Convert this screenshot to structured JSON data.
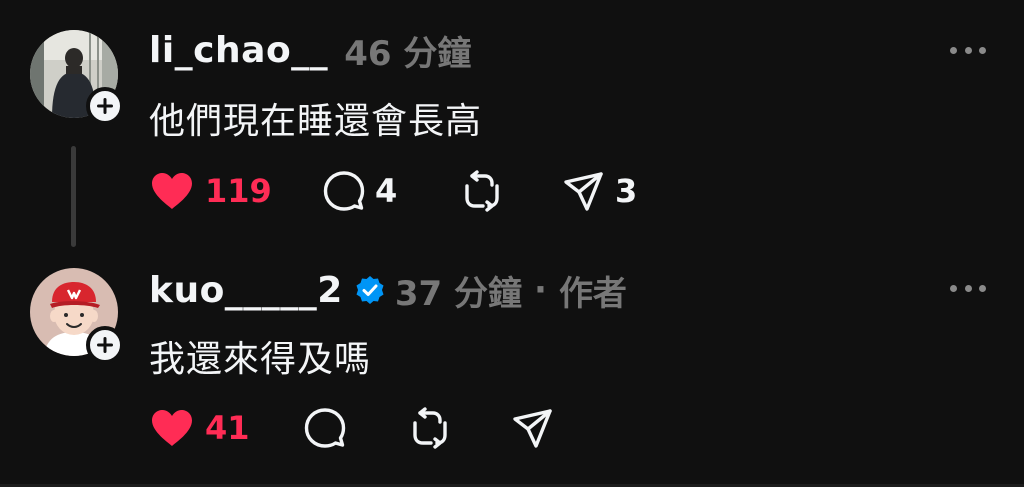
{
  "posts": [
    {
      "username": "li_chao__",
      "timestamp": "46 分鐘",
      "text": "他們現在睡還會長高",
      "likes": "119",
      "replies": "4",
      "reposts": "",
      "shares": "3",
      "liked": true,
      "verified": false,
      "avatar_icon": "profile-photo-icon"
    },
    {
      "username": "kuo_____2",
      "timestamp": "37 分鐘",
      "separator": "·",
      "author_tag": "作者",
      "text": "我還來得及嗎",
      "likes": "41",
      "replies": "",
      "reposts": "",
      "shares": "",
      "liked": true,
      "verified": true,
      "avatar_icon": "cartoon-avatar-icon"
    }
  ],
  "colors": {
    "background": "#101010",
    "like": "#ff2c55",
    "verified": "#0095f6",
    "muted": "#777777",
    "text": "#f3f5f7"
  },
  "icons": {
    "like": "heart-icon",
    "reply": "speech-bubble-icon",
    "repost": "repost-arrows-icon",
    "share": "paper-plane-icon",
    "more": "more-dots-icon",
    "follow": "plus-icon",
    "verified": "verified-badge-icon"
  }
}
